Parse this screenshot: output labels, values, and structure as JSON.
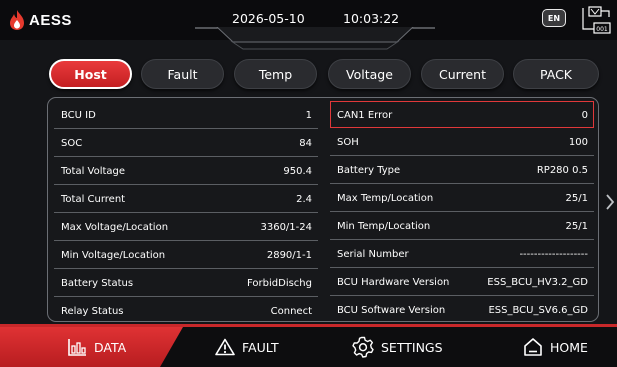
{
  "header": {
    "logo_text": "AESS",
    "date": "2026-05-10",
    "time": "10:03:22",
    "language": "EN",
    "device_icon_label": "001"
  },
  "tabs": [
    {
      "label": "Host",
      "active": true
    },
    {
      "label": "Fault",
      "active": false
    },
    {
      "label": "Temp",
      "active": false
    },
    {
      "label": "Voltage",
      "active": false
    },
    {
      "label": "Current",
      "active": false
    },
    {
      "label": "PACK",
      "active": false
    }
  ],
  "left_rows": [
    {
      "label": "BCU ID",
      "value": "1"
    },
    {
      "label": "SOC",
      "value": "84"
    },
    {
      "label": "Total Voltage",
      "value": "950.4"
    },
    {
      "label": "Total Current",
      "value": "2.4"
    },
    {
      "label": "Max Voltage/Location",
      "value": "3360/1-24"
    },
    {
      "label": "Min Voltage/Location",
      "value": "2890/1-1"
    },
    {
      "label": "Battery Status",
      "value": "ForbidDischg"
    },
    {
      "label": "Relay Status",
      "value": "Connect"
    }
  ],
  "right_rows": [
    {
      "label": "CAN1 Error",
      "value": "0",
      "highlighted": true
    },
    {
      "label": "SOH",
      "value": "100"
    },
    {
      "label": "Battery Type",
      "value": "RP280 0.5"
    },
    {
      "label": "Max Temp/Location",
      "value": "25/1"
    },
    {
      "label": "Min Temp/Location",
      "value": "25/1"
    },
    {
      "label": "Serial Number",
      "value": "-------------------"
    },
    {
      "label": "BCU Hardware Version",
      "value": "ESS_BCU_HV3.2_GD"
    },
    {
      "label": "BCU Software Version",
      "value": "ESS_BCU_SV6.6_GD"
    }
  ],
  "nav": [
    {
      "label": "DATA",
      "icon": "bar-chart-icon",
      "active": true
    },
    {
      "label": "FAULT",
      "icon": "warning-icon",
      "active": false
    },
    {
      "label": "SETTINGS",
      "icon": "gear-icon",
      "active": false
    },
    {
      "label": "HOME",
      "icon": "home-icon",
      "active": false
    }
  ],
  "colors": {
    "accent": "#d42a2c",
    "background": "#141518",
    "panel_border": "#6b6e74",
    "highlight_border": "#e0383a"
  }
}
